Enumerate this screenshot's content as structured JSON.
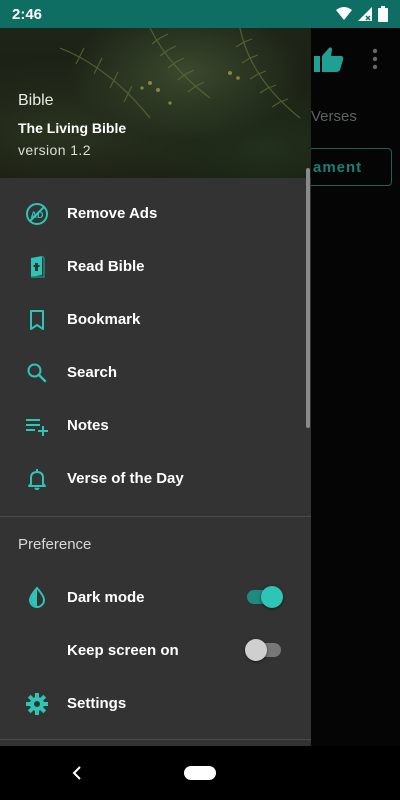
{
  "status_bar": {
    "time": "2:46",
    "icons": [
      "wifi-icon",
      "signal-icon",
      "battery-icon"
    ]
  },
  "background": {
    "verses_text": "Verses",
    "button_text": "ament"
  },
  "drawer": {
    "header": {
      "app_name": "Bible",
      "title": "The Living Bible",
      "version": "version 1.2"
    },
    "items": [
      {
        "label": "Remove Ads",
        "icon": "remove-ads-icon"
      },
      {
        "label": "Read Bible",
        "icon": "bible-book-icon"
      },
      {
        "label": "Bookmark",
        "icon": "bookmark-icon"
      },
      {
        "label": "Search",
        "icon": "search-icon"
      },
      {
        "label": "Notes",
        "icon": "notes-icon"
      },
      {
        "label": "Verse of the Day",
        "icon": "bell-icon"
      }
    ],
    "preference": {
      "title": "Preference",
      "dark_mode": {
        "label": "Dark mode",
        "icon": "dark-mode-icon",
        "enabled": true
      },
      "keep_screen_on": {
        "label": "Keep screen on",
        "enabled": false
      },
      "settings": {
        "label": "Settings",
        "icon": "settings-gear-icon"
      }
    }
  },
  "colors": {
    "accent": "#2ec4b6",
    "status_bar": "#0f6e63",
    "drawer_bg": "#333333"
  }
}
